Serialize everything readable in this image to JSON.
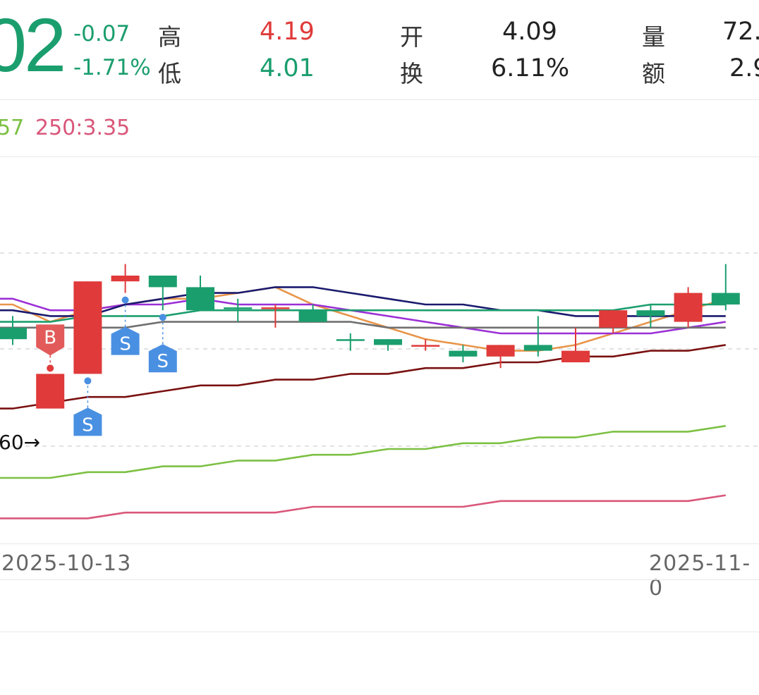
{
  "quote": {
    "price_fragment": "02",
    "change": "-0.07",
    "change_pct": "-1.71%",
    "high_label": "高",
    "high_value": "4.19",
    "low_label": "低",
    "low_value": "4.01",
    "open_label": "开",
    "open_value": "4.09",
    "turnover_label": "换",
    "turnover_value": "6.11%",
    "volume_label": "量",
    "volume_value": "72.",
    "amount_label": "额",
    "amount_value": "2.9"
  },
  "ma_legend": {
    "ma_partial": "57",
    "ma250": "250:3.35"
  },
  "annotations": {
    "price_marker": "60→",
    "buy": "B",
    "sell": "S"
  },
  "x_axis": {
    "start_date": "2025-10-13",
    "end_date": "2025-11-0"
  },
  "colors": {
    "up": "#e03a3a",
    "down": "#1b9e6e",
    "ma250": "#d9577a",
    "ma_green": "#7cc043"
  },
  "chart_data": {
    "type": "candlestick",
    "x_start": "2025-10-13",
    "candles": [
      {
        "open": 4.06,
        "close": 4.04,
        "high": 4.08,
        "low": 4.03,
        "dir": "down"
      },
      {
        "open": 3.92,
        "close": 3.98,
        "high": 3.98,
        "low": 3.92,
        "dir": "up"
      },
      {
        "open": 3.98,
        "close": 4.14,
        "high": 4.14,
        "low": 3.98,
        "dir": "up"
      },
      {
        "open": 4.14,
        "close": 4.15,
        "high": 4.17,
        "low": 4.12,
        "dir": "up"
      },
      {
        "open": 4.15,
        "close": 4.13,
        "high": 4.15,
        "low": 4.09,
        "dir": "down"
      },
      {
        "open": 4.13,
        "close": 4.09,
        "high": 4.15,
        "low": 4.09,
        "dir": "down"
      },
      {
        "open": 4.095,
        "close": 4.093,
        "high": 4.11,
        "low": 4.07,
        "dir": "down"
      },
      {
        "open": 4.093,
        "close": 4.095,
        "high": 4.1,
        "low": 4.06,
        "dir": "up"
      },
      {
        "open": 4.09,
        "close": 4.07,
        "high": 4.1,
        "low": 4.07,
        "dir": "down"
      },
      {
        "open": 4.04,
        "close": 4.04,
        "high": 4.05,
        "low": 4.02,
        "dir": "down"
      },
      {
        "open": 4.04,
        "close": 4.03,
        "high": 4.04,
        "low": 4.02,
        "dir": "down"
      },
      {
        "open": 4.03,
        "close": 4.03,
        "high": 4.04,
        "low": 4.02,
        "dir": "up"
      },
      {
        "open": 4.02,
        "close": 4.01,
        "high": 4.03,
        "low": 4.0,
        "dir": "down"
      },
      {
        "open": 4.01,
        "close": 4.03,
        "high": 4.03,
        "low": 3.99,
        "dir": "up"
      },
      {
        "open": 4.03,
        "close": 4.02,
        "high": 4.08,
        "low": 4.01,
        "dir": "down"
      },
      {
        "open": 4.0,
        "close": 4.02,
        "high": 4.06,
        "low": 4.0,
        "dir": "up"
      },
      {
        "open": 4.06,
        "close": 4.09,
        "high": 4.09,
        "low": 4.05,
        "dir": "up"
      },
      {
        "open": 4.09,
        "close": 4.08,
        "high": 4.1,
        "low": 4.06,
        "dir": "down"
      },
      {
        "open": 4.07,
        "close": 4.12,
        "high": 4.13,
        "low": 4.06,
        "dir": "up"
      },
      {
        "open": 4.12,
        "close": 4.1,
        "high": 4.17,
        "low": 4.09,
        "dir": "down"
      }
    ],
    "ma_lines": [
      {
        "color": "#e8954a",
        "values": [
          4.1,
          4.07,
          4.09,
          4.1,
          4.11,
          4.11,
          4.12,
          4.13,
          4.1,
          4.08,
          4.06,
          4.04,
          4.03,
          4.02,
          4.02,
          4.03,
          4.05,
          4.07,
          4.09,
          4.11
        ]
      },
      {
        "color": "#9b2fd6",
        "values": [
          4.11,
          4.09,
          4.09,
          4.1,
          4.1,
          4.11,
          4.1,
          4.1,
          4.1,
          4.09,
          4.08,
          4.07,
          4.06,
          4.05,
          4.05,
          4.05,
          4.05,
          4.05,
          4.06,
          4.07
        ]
      },
      {
        "color": "#1a1a6e",
        "values": [
          4.09,
          4.08,
          4.08,
          4.1,
          4.11,
          4.12,
          4.12,
          4.13,
          4.13,
          4.12,
          4.11,
          4.1,
          4.1,
          4.09,
          4.09,
          4.08,
          4.08,
          4.08,
          4.08,
          4.08
        ]
      },
      {
        "color": "#1b9e6e",
        "values": [
          4.07,
          4.07,
          4.08,
          4.08,
          4.08,
          4.09,
          4.09,
          4.09,
          4.09,
          4.09,
          4.09,
          4.09,
          4.09,
          4.09,
          4.09,
          4.09,
          4.09,
          4.1,
          4.1,
          4.1
        ]
      },
      {
        "color": "#707070",
        "values": [
          4.06,
          4.06,
          4.06,
          4.06,
          4.07,
          4.07,
          4.07,
          4.07,
          4.07,
          4.07,
          4.06,
          4.06,
          4.06,
          4.06,
          4.06,
          4.06,
          4.06,
          4.06,
          4.06,
          4.06
        ]
      },
      {
        "color": "#7a1010",
        "values": [
          3.92,
          3.93,
          3.94,
          3.94,
          3.95,
          3.96,
          3.96,
          3.97,
          3.97,
          3.98,
          3.98,
          3.99,
          3.99,
          4.0,
          4.0,
          4.01,
          4.01,
          4.02,
          4.02,
          4.03
        ]
      },
      {
        "color": "#7cc043",
        "values": [
          3.8,
          3.8,
          3.81,
          3.81,
          3.82,
          3.82,
          3.83,
          3.83,
          3.84,
          3.84,
          3.85,
          3.85,
          3.86,
          3.86,
          3.87,
          3.87,
          3.88,
          3.88,
          3.88,
          3.89
        ]
      },
      {
        "color": "#d9577a",
        "values": [
          3.73,
          3.73,
          3.73,
          3.74,
          3.74,
          3.74,
          3.74,
          3.74,
          3.75,
          3.75,
          3.75,
          3.75,
          3.75,
          3.76,
          3.76,
          3.76,
          3.76,
          3.76,
          3.76,
          3.77
        ]
      }
    ],
    "signals": [
      {
        "type": "B",
        "index": 1
      },
      {
        "type": "S",
        "index": 2
      },
      {
        "type": "S",
        "index": 3
      },
      {
        "type": "S",
        "index": 4
      }
    ],
    "y_range": [
      3.7,
      4.2
    ]
  }
}
